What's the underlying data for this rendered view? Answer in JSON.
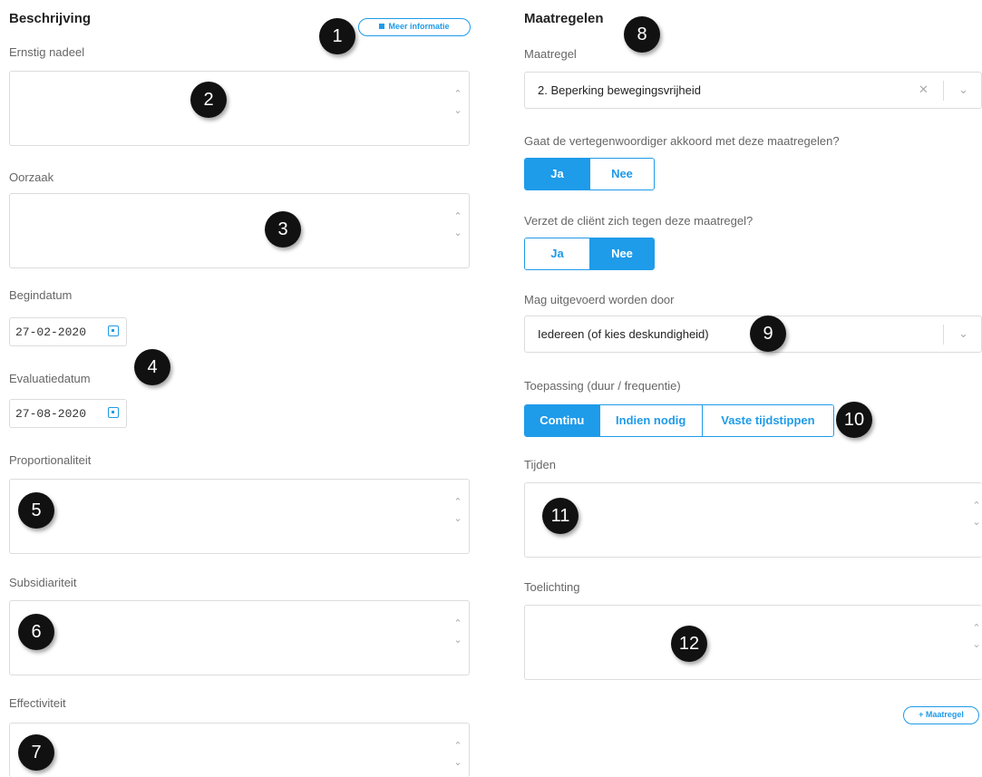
{
  "left": {
    "title": "Beschrijving",
    "info_button": "Meer informatie",
    "fields": {
      "ernstig_nadeel": "Ernstig nadeel",
      "oorzaak": "Oorzaak",
      "begindatum": "Begindatum",
      "begindatum_value": "27-02-2020",
      "evaluatiedatum": "Evaluatiedatum",
      "evaluatiedatum_value": "27-08-2020",
      "proportionaliteit": "Proportionaliteit",
      "subsidiariteit": "Subsidiariteit",
      "effectiviteit": "Effectiviteit"
    }
  },
  "right": {
    "title": "Maatregelen",
    "maatregel_label": "Maatregel",
    "maatregel_value": "2. Beperking bewegingsvrijheid",
    "q1": "Gaat de vertegenwoordiger akkoord met deze maatregelen?",
    "q1_options": [
      "Ja",
      "Nee"
    ],
    "q1_selected": "Ja",
    "q2": "Verzet de cliënt zich tegen deze maatregel?",
    "q2_options": [
      "Ja",
      "Nee"
    ],
    "q2_selected": "Nee",
    "uitgevoerd_label": "Mag uitgevoerd worden door",
    "uitgevoerd_value": "Iedereen (of kies deskundigheid)",
    "toepassing_label": "Toepassing (duur / frequentie)",
    "toepassing_options": [
      "Continu",
      "Indien nodig",
      "Vaste tijdstippen"
    ],
    "toepassing_selected": "Continu",
    "tijden_label": "Tijden",
    "toelichting_label": "Toelichting",
    "add_button": "+ Maatregel"
  },
  "badges": [
    "1",
    "2",
    "3",
    "4",
    "5",
    "6",
    "7",
    "8",
    "9",
    "10",
    "11",
    "12"
  ],
  "colors": {
    "accent": "#1e9be9",
    "badge": "#111111"
  }
}
